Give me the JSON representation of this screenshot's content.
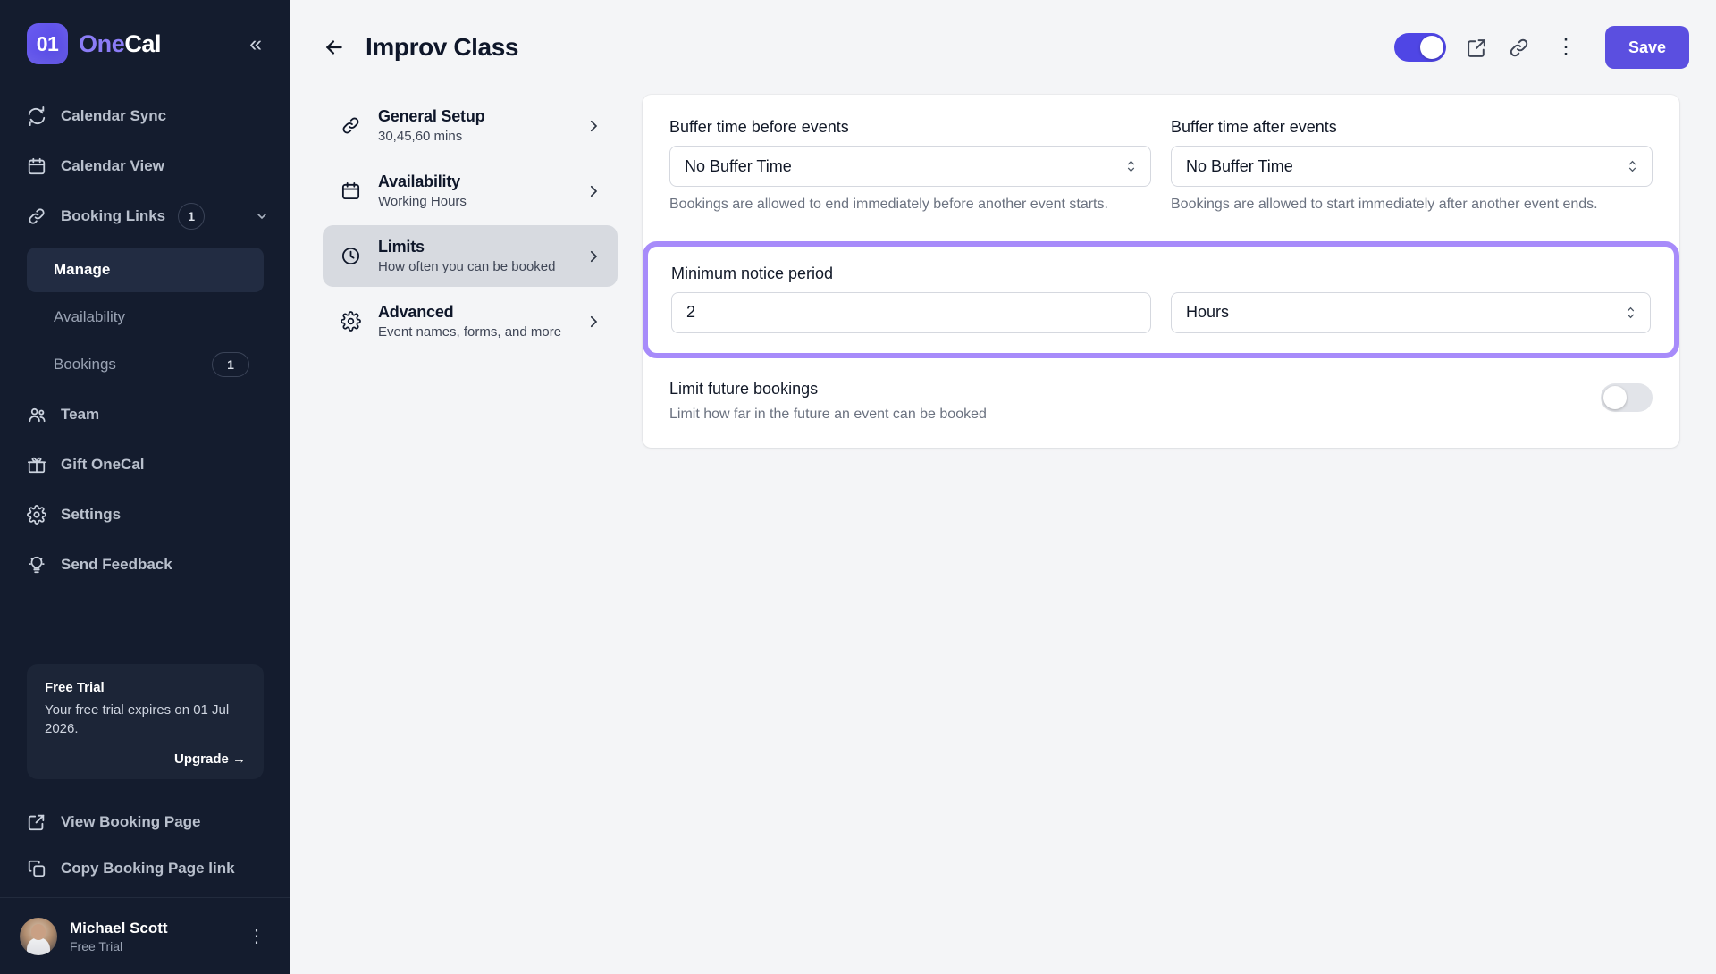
{
  "brand": {
    "logo_text": "01",
    "name_part1": "One",
    "name_part2": "Cal",
    "collapse_icon": "«"
  },
  "sidebar": {
    "nav": [
      {
        "label": "Calendar Sync",
        "icon": "sync-icon"
      },
      {
        "label": "Calendar View",
        "icon": "calendar-icon"
      },
      {
        "label": "Booking Links",
        "icon": "link-icon",
        "badge": "1",
        "chevron": "⌄"
      }
    ],
    "subnav": [
      {
        "label": "Manage",
        "active": true
      },
      {
        "label": "Availability",
        "active": false
      },
      {
        "label": "Bookings",
        "active": false,
        "badge": "1"
      }
    ],
    "nav2": [
      {
        "label": "Team",
        "icon": "team-icon"
      },
      {
        "label": "Gift OneCal",
        "icon": "gift-icon"
      },
      {
        "label": "Settings",
        "icon": "gear-icon"
      },
      {
        "label": "Send Feedback",
        "icon": "lightbulb-icon"
      }
    ],
    "trial": {
      "title": "Free Trial",
      "text": "Your free trial expires on 01 Jul 2026.",
      "upgrade": "Upgrade →"
    },
    "bottom": [
      {
        "label": "View Booking Page",
        "icon": "external-link-icon"
      },
      {
        "label": "Copy Booking Page link",
        "icon": "copy-icon"
      }
    ],
    "user": {
      "name": "Michael Scott",
      "plan": "Free Trial",
      "menu_icon": "⋮"
    }
  },
  "topbar": {
    "back_icon": "←",
    "title": "Improv Class",
    "enabled_toggle": true,
    "preview_icon": "external-link-icon",
    "link_icon": "link-icon",
    "more_icon": "⋮",
    "save_label": "Save"
  },
  "subpanel": {
    "items": [
      {
        "title": "General Setup",
        "subtitle": "30,45,60 mins",
        "icon": "link-icon",
        "active": false
      },
      {
        "title": "Availability",
        "subtitle": "Working Hours",
        "icon": "calendar-icon",
        "active": false
      },
      {
        "title": "Limits",
        "subtitle": "How often you can be booked",
        "icon": "clock-icon",
        "active": true
      },
      {
        "title": "Advanced",
        "subtitle": "Event names, forms, and more",
        "icon": "gear-icon",
        "active": false
      }
    ],
    "chevron": "›"
  },
  "limits": {
    "buffer_before": {
      "label": "Buffer time before events",
      "value": "No Buffer Time",
      "helper": "Bookings are allowed to end immediately before another event starts."
    },
    "buffer_after": {
      "label": "Buffer time after events",
      "value": "No Buffer Time",
      "helper": "Bookings are allowed to start immediately after another event ends."
    },
    "minimum_notice": {
      "label": "Minimum notice period",
      "amount": "2",
      "unit": "Hours",
      "highlight_color": "#a78bfa"
    },
    "limit_future": {
      "label": "Limit future bookings",
      "description": "Limit how far in the future an event can be booked",
      "enabled": false
    }
  },
  "colors": {
    "accent": "#5b4fe0",
    "sidebar_bg": "#141c2e",
    "highlight": "#a78bfa"
  }
}
